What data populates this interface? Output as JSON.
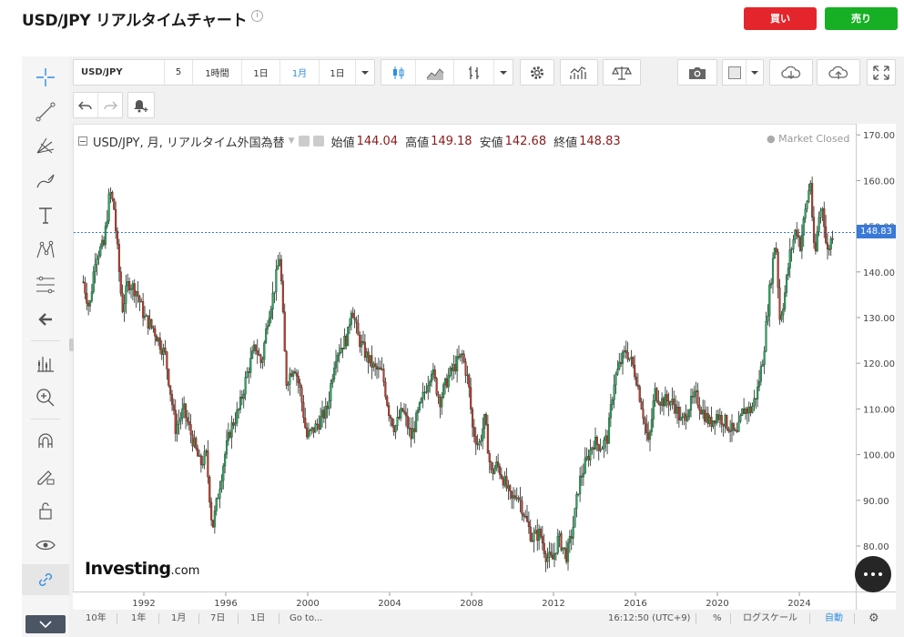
{
  "header": {
    "title": "USD/JPY リアルタイムチャート",
    "sell_label": "買い",
    "buy_label": "売り"
  },
  "toolbar": {
    "symbol": "USD/JPY",
    "intervals": [
      "5",
      "1時間",
      "1日",
      "1月",
      "1日"
    ],
    "active_interval": 3
  },
  "legend": {
    "name": "USD/JPY, 月, リアルタイム外国為替",
    "open_label": "始値",
    "open": "144.04",
    "high_label": "高値",
    "high": "149.18",
    "low_label": "安値",
    "low": "142.68",
    "close_label": "終値",
    "close": "148.83",
    "status": "Market Closed"
  },
  "logo": {
    "main": "Investing",
    "suffix": ".com"
  },
  "bottom_bar": {
    "ranges": [
      "10年",
      "1年",
      "1月",
      "7日",
      "1日",
      "Go to..."
    ],
    "time": "16:12:50 (UTC+9)",
    "percent": "%",
    "log_scale": "ログスケール",
    "auto": "自動"
  },
  "colors": {
    "up": "#26a65b",
    "down": "#c0392b",
    "accent": "#2f8fe0",
    "last_price": "#3979d8"
  },
  "chart_data": {
    "type": "candlestick",
    "title": "USD/JPY, 月, リアルタイム外国為替",
    "ylim": [
      75,
      172
    ],
    "y_ticks": [
      80,
      90,
      100,
      110,
      120,
      130,
      140,
      150,
      160,
      170
    ],
    "x_ticks": [
      "1992",
      "1996",
      "2000",
      "2004",
      "2008",
      "2012",
      "2016",
      "2020",
      "2024"
    ],
    "last_price": 148.83,
    "path": [
      [
        1989.0,
        138
      ],
      [
        1989.3,
        132
      ],
      [
        1989.6,
        144
      ],
      [
        1990.0,
        146
      ],
      [
        1990.3,
        158
      ],
      [
        1990.5,
        154
      ],
      [
        1990.9,
        132
      ],
      [
        1991.2,
        138
      ],
      [
        1991.6,
        136
      ],
      [
        1992.0,
        130
      ],
      [
        1992.4,
        128
      ],
      [
        1992.8,
        124
      ],
      [
        1993.0,
        122
      ],
      [
        1993.5,
        106
      ],
      [
        1993.9,
        110
      ],
      [
        1994.3,
        104
      ],
      [
        1994.7,
        98
      ],
      [
        1995.0,
        100
      ],
      [
        1995.3,
        84
      ],
      [
        1995.6,
        92
      ],
      [
        1995.9,
        100
      ],
      [
        1996.2,
        106
      ],
      [
        1996.6,
        110
      ],
      [
        1997.0,
        118
      ],
      [
        1997.4,
        124
      ],
      [
        1997.7,
        120
      ],
      [
        1998.0,
        130
      ],
      [
        1998.3,
        136
      ],
      [
        1998.6,
        144
      ],
      [
        1998.9,
        116
      ],
      [
        1999.3,
        120
      ],
      [
        1999.6,
        114
      ],
      [
        1999.9,
        104
      ],
      [
        2000.3,
        106
      ],
      [
        2000.6,
        108
      ],
      [
        2000.9,
        110
      ],
      [
        2001.3,
        122
      ],
      [
        2001.6,
        124
      ],
      [
        2001.9,
        126
      ],
      [
        2002.1,
        133
      ],
      [
        2002.4,
        126
      ],
      [
        2002.8,
        122
      ],
      [
        2003.2,
        119
      ],
      [
        2003.6,
        118
      ],
      [
        2003.9,
        110
      ],
      [
        2004.2,
        106
      ],
      [
        2004.6,
        110
      ],
      [
        2005.0,
        104
      ],
      [
        2005.4,
        110
      ],
      [
        2005.8,
        116
      ],
      [
        2006.0,
        119
      ],
      [
        2006.4,
        112
      ],
      [
        2006.8,
        117
      ],
      [
        2007.2,
        120
      ],
      [
        2007.5,
        122
      ],
      [
        2007.8,
        116
      ],
      [
        2008.0,
        106
      ],
      [
        2008.3,
        102
      ],
      [
        2008.6,
        108
      ],
      [
        2008.9,
        96
      ],
      [
        2009.2,
        98
      ],
      [
        2009.5,
        95
      ],
      [
        2009.9,
        90
      ],
      [
        2010.2,
        92
      ],
      [
        2010.6,
        86
      ],
      [
        2010.9,
        82
      ],
      [
        2011.3,
        83
      ],
      [
        2011.6,
        78
      ],
      [
        2011.9,
        77
      ],
      [
        2012.2,
        82
      ],
      [
        2012.6,
        78
      ],
      [
        2012.9,
        84
      ],
      [
        2013.2,
        94
      ],
      [
        2013.5,
        98
      ],
      [
        2013.9,
        103
      ],
      [
        2014.3,
        102
      ],
      [
        2014.6,
        104
      ],
      [
        2014.9,
        116
      ],
      [
        2015.2,
        120
      ],
      [
        2015.5,
        123
      ],
      [
        2015.8,
        120
      ],
      [
        2016.0,
        117
      ],
      [
        2016.3,
        110
      ],
      [
        2016.6,
        102
      ],
      [
        2016.9,
        114
      ],
      [
        2017.2,
        112
      ],
      [
        2017.6,
        112
      ],
      [
        2017.9,
        111
      ],
      [
        2018.2,
        107
      ],
      [
        2018.6,
        111
      ],
      [
        2018.9,
        113
      ],
      [
        2019.2,
        110
      ],
      [
        2019.6,
        107
      ],
      [
        2019.9,
        109
      ],
      [
        2020.2,
        108
      ],
      [
        2020.6,
        106
      ],
      [
        2020.9,
        104
      ],
      [
        2021.2,
        110
      ],
      [
        2021.6,
        110
      ],
      [
        2021.9,
        114
      ],
      [
        2022.2,
        122
      ],
      [
        2022.5,
        136
      ],
      [
        2022.8,
        148
      ],
      [
        2023.0,
        130
      ],
      [
        2023.2,
        134
      ],
      [
        2023.5,
        144
      ],
      [
        2023.8,
        150
      ],
      [
        2024.0,
        146
      ],
      [
        2024.3,
        155
      ],
      [
        2024.5,
        160
      ],
      [
        2024.7,
        142
      ],
      [
        2024.9,
        152
      ],
      [
        2025.1,
        155
      ],
      [
        2025.3,
        144
      ],
      [
        2025.6,
        148.83
      ]
    ]
  }
}
